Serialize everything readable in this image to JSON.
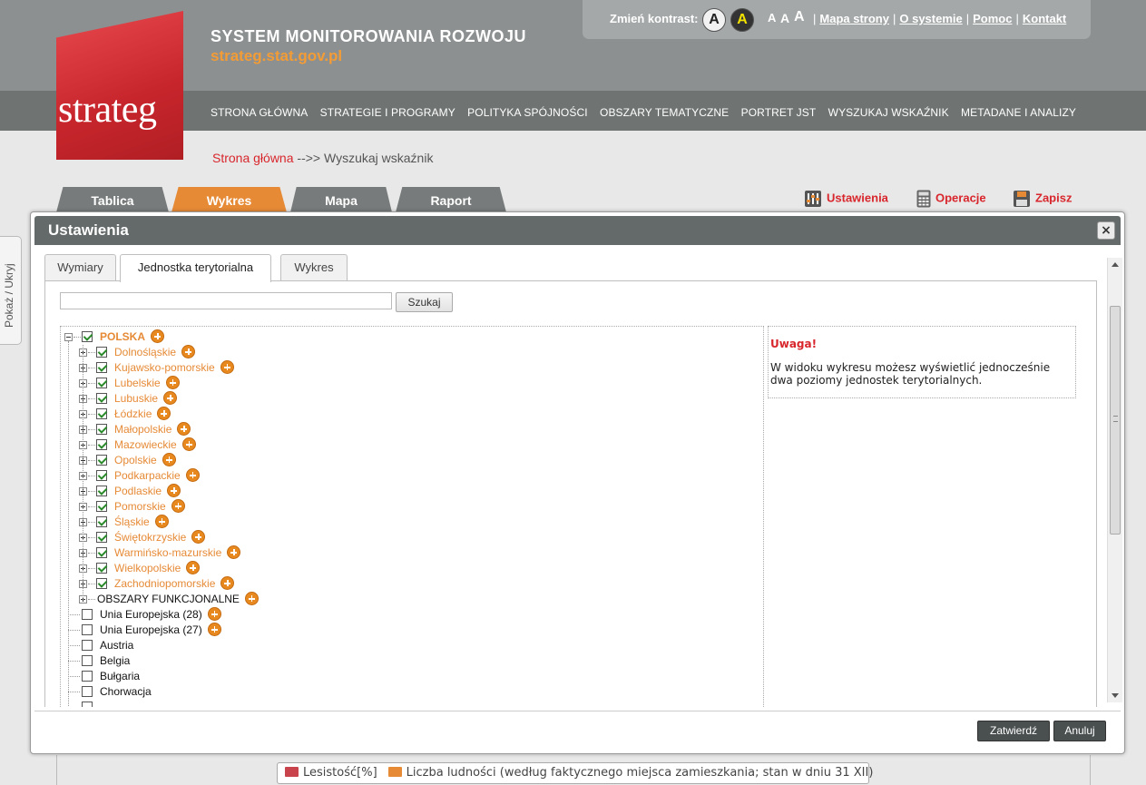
{
  "header": {
    "logo_text": "strateg",
    "system_title": "SYSTEM MONITOROWANIA ROZWOJU",
    "url": "strateg.stat.gov.pl",
    "contrast_label": "Zmień kontrast:",
    "contrast_a1": "A",
    "contrast_a2": "A",
    "font_sizes": [
      "A",
      "A",
      "A"
    ],
    "links": [
      "Mapa strony",
      "O systemie",
      "Pomoc",
      "Kontakt"
    ],
    "link_separator": "|",
    "nav": [
      "STRONA GŁÓWNA",
      "STRATEGIE I PROGRAMY",
      "POLITYKA SPÓJNOŚCI",
      "OBSZARY TEMATYCZNE",
      "PORTRET JST",
      "WYSZUKAJ WSKAŹNIK",
      "METADANE I ANALIZY"
    ]
  },
  "breadcrumb": {
    "home": "Strona główna",
    "separator": "-->>",
    "current": "Wyszukaj wskaźnik"
  },
  "main_tabs": [
    "Tablica",
    "Wykres",
    "Mapa",
    "Raport"
  ],
  "tools": {
    "settings": "Ustawienia",
    "operations": "Operacje",
    "save": "Zapisz"
  },
  "side_toggle": "Pokaż / Ukryj",
  "dialog": {
    "title": "Ustawienia",
    "close": "×",
    "tabs": [
      "Wymiary",
      "Jednostka terytorialna",
      "Wykres"
    ],
    "search_button": "Szukaj",
    "search_value": "",
    "tree": {
      "root": "POLSKA",
      "regions": [
        "Dolnośląskie",
        "Kujawsko-pomorskie",
        "Lubelskie",
        "Lubuskie",
        "Łódzkie",
        "Małopolskie",
        "Mazowieckie",
        "Opolskie",
        "Podkarpackie",
        "Podlaskie",
        "Pomorskie",
        "Śląskie",
        "Świętokrzyskie",
        "Warmińsko-mazurskie",
        "Wielkopolskie",
        "Zachodniopomorskie"
      ],
      "functional": "OBSZARY FUNKCJONALNE",
      "other": [
        {
          "label": "Unia Europejska (28)",
          "plus": true
        },
        {
          "label": "Unia Europejska (27)",
          "plus": true
        },
        {
          "label": "Austria",
          "plus": false
        },
        {
          "label": "Belgia",
          "plus": false
        },
        {
          "label": "Bułgaria",
          "plus": false
        },
        {
          "label": "Chorwacja",
          "plus": false
        }
      ]
    },
    "note_head": "Uwaga!",
    "note_text": "W widoku wykresu możesz wyświetlić jednocześnie dwa poziomy jednostek terytorialnych.",
    "confirm": "Zatwierdź",
    "cancel": "Anuluj"
  },
  "legend": [
    {
      "label": "Lesistość[%]",
      "color": "#c8434b"
    },
    {
      "label": "Liczba ludności (według faktycznego miejsca zamieszkania; stan w dniu 31 XII)",
      "color": "#e68a36"
    }
  ],
  "colors": {
    "accent_orange": "#e68a36",
    "accent_red": "#d8262c",
    "header_gray": "#8c9091"
  }
}
